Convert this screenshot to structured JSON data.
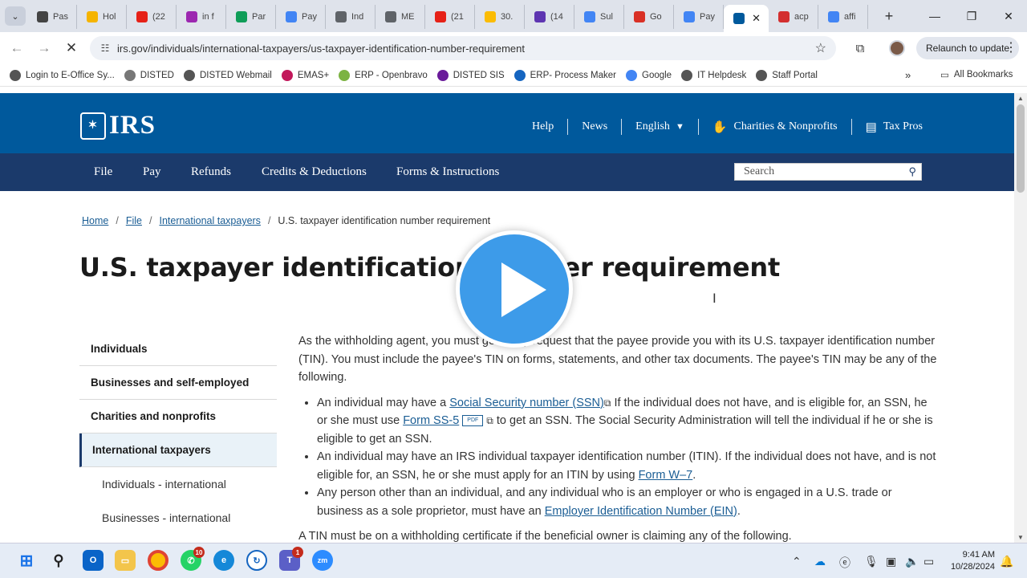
{
  "browser": {
    "tabs": [
      {
        "label": "Pas",
        "icon": "paypal-p-icon",
        "color": "#444"
      },
      {
        "label": "Hol",
        "icon": "plane-icon",
        "color": "#f5b400"
      },
      {
        "label": "(22",
        "icon": "youtube-icon",
        "color": "#e62117"
      },
      {
        "label": "in f",
        "icon": "app-icon",
        "color": "#9c27b0"
      },
      {
        "label": "Par",
        "icon": "sheets-icon",
        "color": "#0f9d58"
      },
      {
        "label": "Pay",
        "icon": "pay-icon",
        "color": "#4285f4"
      },
      {
        "label": "Ind",
        "icon": "globe-icon",
        "color": "#5f6368"
      },
      {
        "label": "ME",
        "icon": "globe-icon",
        "color": "#5f6368"
      },
      {
        "label": "(21",
        "icon": "youtube-icon",
        "color": "#e62117"
      },
      {
        "label": "30.",
        "icon": "drive-icon",
        "color": "#fbbc04"
      },
      {
        "label": "(14",
        "icon": "mail-icon",
        "color": "#5e35b1"
      },
      {
        "label": "Sul",
        "icon": "google-icon",
        "color": "#4285f4"
      },
      {
        "label": "Go",
        "icon": "gmail-icon",
        "color": "#d93025"
      },
      {
        "label": "Pay",
        "icon": "pay-icon",
        "color": "#4285f4"
      }
    ],
    "active_tab": {
      "label": "",
      "icon": "irs-eagle-icon"
    },
    "tabs_after": [
      {
        "label": "acp",
        "icon": "pdf-icon",
        "color": "#d32f2f"
      },
      {
        "label": "affi",
        "icon": "google-icon",
        "color": "#4285f4"
      }
    ],
    "url": "irs.gov/individuals/international-taxpayers/us-taxpayer-identification-number-requirement",
    "relaunch_label": "Relaunch to update",
    "bookmarks": [
      {
        "label": "Login to E-Office Sy...",
        "icon": "eoffice-icon",
        "color": "#555"
      },
      {
        "label": "DISTED",
        "icon": "disted-icon",
        "color": "#777"
      },
      {
        "label": "DISTED Webmail",
        "icon": "webmail-icon",
        "color": "#555"
      },
      {
        "label": "EMAS+",
        "icon": "emas-icon",
        "color": "#c2185b"
      },
      {
        "label": "ERP - Openbravo",
        "icon": "openbravo-icon",
        "color": "#7cb342"
      },
      {
        "label": "DISTED SIS",
        "icon": "sis-icon",
        "color": "#6a1b9a"
      },
      {
        "label": "ERP- Process Maker",
        "icon": "processmaker-icon",
        "color": "#1565c0"
      },
      {
        "label": "Google",
        "icon": "google-icon",
        "color": "#4285f4"
      },
      {
        "label": "IT Helpdesk",
        "icon": "helpdesk-icon",
        "color": "#555"
      },
      {
        "label": "Staff Portal",
        "icon": "portal-icon",
        "color": "#555"
      }
    ],
    "all_bookmarks": "All Bookmarks"
  },
  "site": {
    "logo": "IRS",
    "top_links": {
      "help": "Help",
      "news": "News",
      "english": "English",
      "charities": "Charities & Nonprofits",
      "tax_pros": "Tax Pros"
    },
    "nav": [
      "File",
      "Pay",
      "Refunds",
      "Credits & Deductions",
      "Forms & Instructions"
    ],
    "search_placeholder": "Search",
    "breadcrumb": [
      "Home",
      "File",
      "International taxpayers",
      "U.S. taxpayer identification number requirement"
    ],
    "title": "U.S. taxpayer identification number requirement",
    "sidenav": [
      "Individuals",
      "Businesses and self-employed",
      "Charities and nonprofits",
      "International taxpayers",
      "Individuals - international",
      "Businesses - international"
    ],
    "content": {
      "intro": "As the withholding agent, you must generally request that the payee provide you with its U.S. taxpayer identification number (TIN). You must include the payee's TIN on forms, statements, and other tax documents. The payee's TIN may be any of the following.",
      "b1_pre": "An individual may have a ",
      "b1_link": "Social Security number (SSN)",
      "b1_mid": " If the individual does not have, and is eligible for, an SSN, he or she must use ",
      "b1_link2": "Form SS-5",
      "pdf": "PDF",
      "b1_post": " to get an SSN. The Social Security Administration will tell the individual if he or she is eligible to get an SSN.",
      "b2_pre": "An individual may have an IRS individual taxpayer identification number (ITIN). If the individual does not have, and is not eligible for, an SSN, he or she must apply for an ITIN by using ",
      "b2_link": "Form W–7",
      "b2_post": ".",
      "b3_pre": "Any person other than an individual, and any individual who is an employer or who is engaged in a U.S. trade or business as a sole proprietor, must have an ",
      "b3_link": "Employer Identification Number (EIN)",
      "b3_post": ".",
      "outro": "A TIN must be on a withholding certificate if the beneficial owner is claiming any of the following."
    }
  },
  "taskbar": {
    "time": "9:41 AM",
    "date": "10/28/2024",
    "whatsapp_badge": "10",
    "teams_badge": "1"
  }
}
